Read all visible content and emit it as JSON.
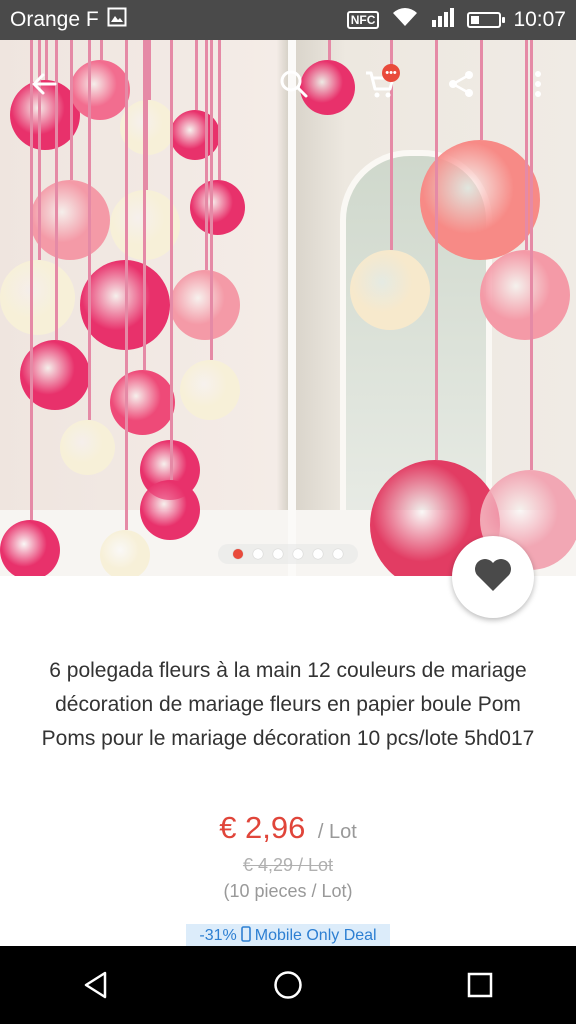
{
  "status_bar": {
    "carrier": "Orange F",
    "nfc_label": "NFC",
    "time": "10:07",
    "battery_level": 0.3,
    "icons": [
      "image-icon",
      "nfc-icon",
      "wifi-icon",
      "signal-icon",
      "battery-icon"
    ]
  },
  "toolbar": {
    "icons": [
      "back-arrow-icon",
      "search-icon",
      "cart-icon",
      "share-icon",
      "more-vert-icon"
    ],
    "cart_badge": "•••"
  },
  "carousel": {
    "image_count": 6,
    "active_index": 0
  },
  "product": {
    "title": "6 polegada fleurs à la main 12 couleurs de mariage décoration de mariage fleurs en papier boule Pom Poms pour le mariage décoration 10 pcs/lote 5hd017",
    "price": "€ 2,96",
    "price_unit": "/ Lot",
    "old_price": "€ 4,29 / Lot",
    "pieces": "(10 pieces / Lot)",
    "deal_discount": "-31%",
    "deal_label": "Mobile Only Deal"
  },
  "colors": {
    "accent_red": "#e0453a",
    "deal_blue": "#2d7fd2",
    "deal_bg": "#dcecfa",
    "status_bar": "#4a4a4a"
  },
  "nav_bar": {
    "icons": [
      "back-triangle-icon",
      "home-circle-icon",
      "recents-square-icon"
    ]
  }
}
